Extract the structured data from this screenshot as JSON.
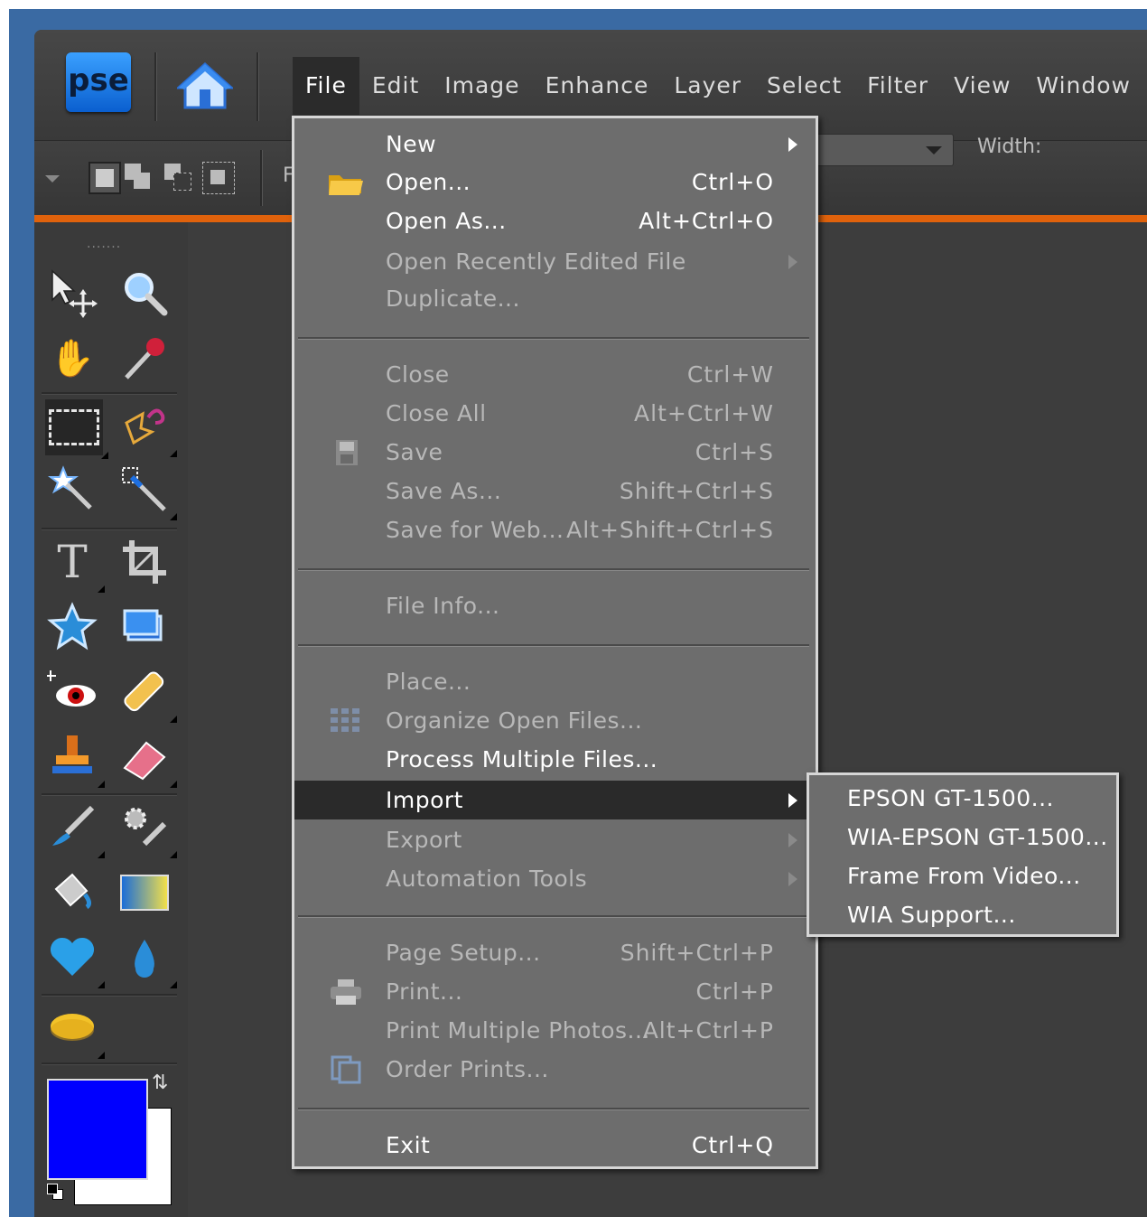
{
  "app": {
    "logo_text": "pse",
    "menubar": [
      "File",
      "Edit",
      "Image",
      "Enhance",
      "Layer",
      "Select",
      "Filter",
      "View",
      "Window"
    ],
    "active_menu": "File",
    "optbar": {
      "width_label": "Width:",
      "truncated_label": "F"
    }
  },
  "file_menu": {
    "items": [
      {
        "label": "New",
        "shortcut": "",
        "disabled": false,
        "submenu": true
      },
      {
        "label": "Open...",
        "shortcut": "Ctrl+O",
        "disabled": false,
        "icon": "folder-icon"
      },
      {
        "label": "Open As...",
        "shortcut": "Alt+Ctrl+O",
        "disabled": false
      },
      {
        "label": "Open Recently Edited File",
        "shortcut": "",
        "disabled": true,
        "submenu": true
      },
      {
        "label": "Duplicate...",
        "shortcut": "",
        "disabled": true
      },
      {
        "label": "Close",
        "shortcut": "Ctrl+W",
        "disabled": true
      },
      {
        "label": "Close All",
        "shortcut": "Alt+Ctrl+W",
        "disabled": true
      },
      {
        "label": "Save",
        "shortcut": "Ctrl+S",
        "disabled": true,
        "icon": "floppy-icon"
      },
      {
        "label": "Save As...",
        "shortcut": "Shift+Ctrl+S",
        "disabled": true
      },
      {
        "label": "Save for Web...",
        "shortcut": "Alt+Shift+Ctrl+S",
        "disabled": true
      },
      {
        "label": "File Info...",
        "shortcut": "",
        "disabled": true
      },
      {
        "label": "Place...",
        "shortcut": "",
        "disabled": true
      },
      {
        "label": "Organize Open Files...",
        "shortcut": "",
        "disabled": true,
        "icon": "grid-icon"
      },
      {
        "label": "Process Multiple Files...",
        "shortcut": "",
        "disabled": false
      },
      {
        "label": "Import",
        "shortcut": "",
        "disabled": false,
        "submenu": true,
        "highlighted": true
      },
      {
        "label": "Export",
        "shortcut": "",
        "disabled": true,
        "submenu": true
      },
      {
        "label": "Automation Tools",
        "shortcut": "",
        "disabled": true,
        "submenu": true
      },
      {
        "label": "Page Setup...",
        "shortcut": "Shift+Ctrl+P",
        "disabled": true
      },
      {
        "label": "Print...",
        "shortcut": "Ctrl+P",
        "disabled": true,
        "icon": "printer-icon"
      },
      {
        "label": "Print Multiple Photos...",
        "shortcut": "Alt+Ctrl+P",
        "disabled": true
      },
      {
        "label": "Order Prints...",
        "shortcut": "",
        "disabled": true,
        "icon": "order-prints-icon"
      },
      {
        "label": "Exit",
        "shortcut": "Ctrl+Q",
        "disabled": false
      }
    ]
  },
  "import_submenu": [
    "EPSON GT-1500...",
    "WIA-EPSON GT-1500...",
    "Frame From Video...",
    "WIA Support..."
  ],
  "colors": {
    "foreground": "#0000ff",
    "background": "#ffffff",
    "accent": "#e0620c"
  }
}
